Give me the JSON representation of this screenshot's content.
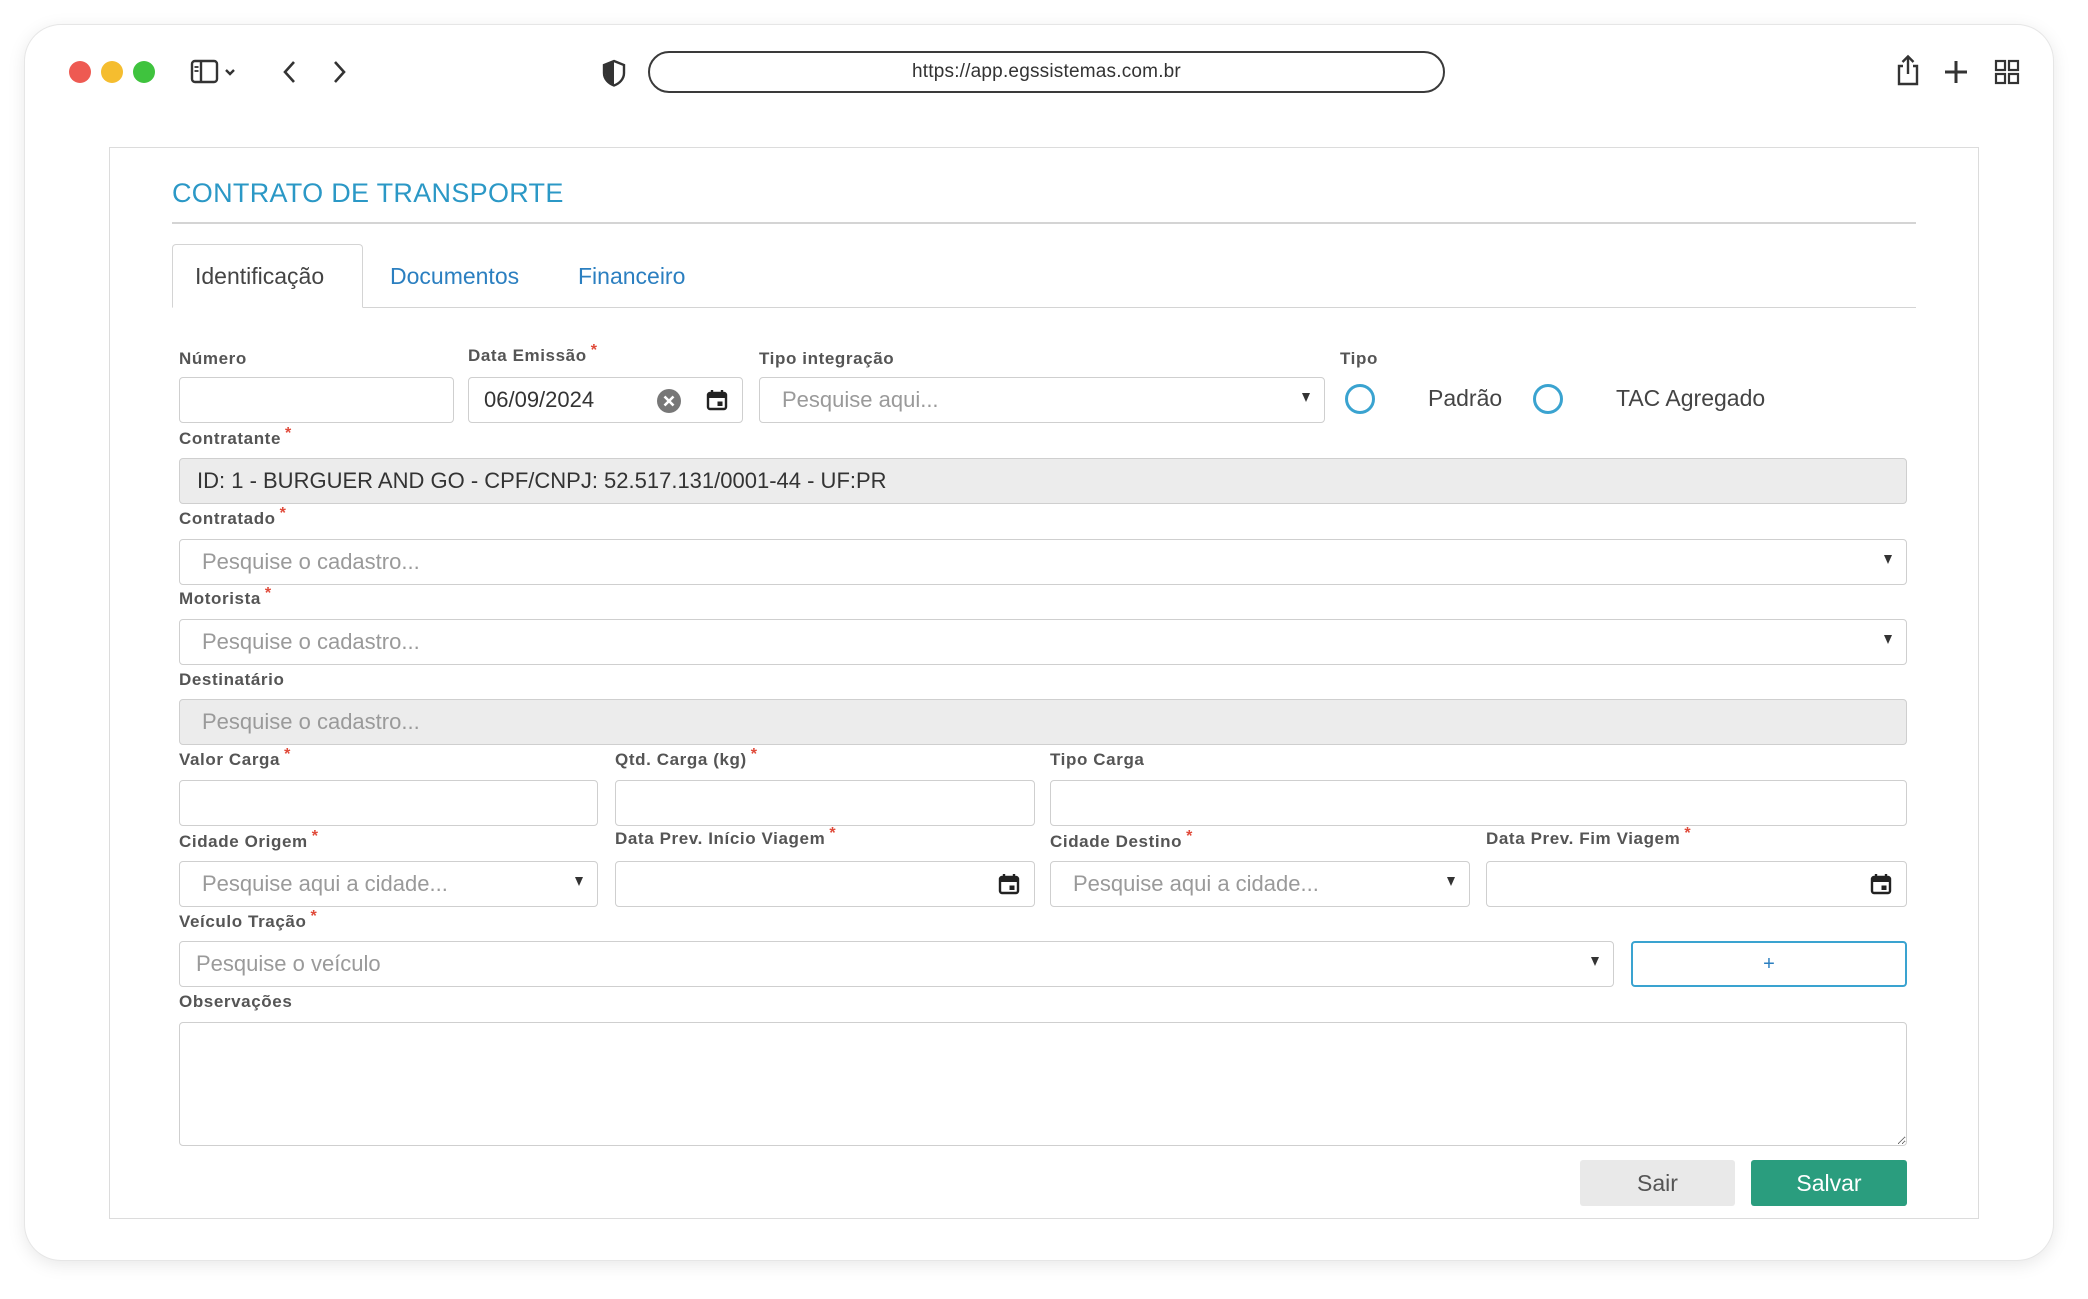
{
  "browser": {
    "url": "https://app.egssistemas.com.br"
  },
  "page": {
    "title": "CONTRATO DE TRANSPORTE",
    "tabs": [
      {
        "label": "Identificação",
        "active": true
      },
      {
        "label": "Documentos",
        "active": false
      },
      {
        "label": "Financeiro",
        "active": false
      }
    ]
  },
  "form": {
    "numero": {
      "label": "Número",
      "value": ""
    },
    "data_emissao": {
      "label": "Data Emissão",
      "value": "06/09/2024",
      "required": true
    },
    "tipo_integracao": {
      "label": "Tipo integração",
      "placeholder": "Pesquise aqui..."
    },
    "tipo": {
      "label": "Tipo",
      "options": [
        "Padrão",
        "TAC Agregado"
      ]
    },
    "contratante": {
      "label": "Contratante",
      "value": "ID: 1 - BURGUER AND GO - CPF/CNPJ: 52.517.131/0001-44 - UF:PR",
      "required": true
    },
    "contratado": {
      "label": "Contratado",
      "placeholder": "Pesquise o cadastro...",
      "required": true
    },
    "motorista": {
      "label": "Motorista",
      "placeholder": "Pesquise o cadastro...",
      "required": true
    },
    "destinatario": {
      "label": "Destinatário",
      "placeholder": "Pesquise o cadastro..."
    },
    "valor_carga": {
      "label": "Valor Carga",
      "required": true
    },
    "qtd_carga": {
      "label": "Qtd. Carga (kg)",
      "required": true
    },
    "tipo_carga": {
      "label": "Tipo Carga"
    },
    "cidade_origem": {
      "label": "Cidade Origem",
      "placeholder": "Pesquise aqui a cidade...",
      "required": true
    },
    "data_inicio": {
      "label": "Data Prev. Início Viagem",
      "required": true
    },
    "cidade_destino": {
      "label": "Cidade Destino",
      "placeholder": "Pesquise aqui a cidade...",
      "required": true
    },
    "data_fim": {
      "label": "Data Prev. Fim Viagem",
      "required": true
    },
    "veiculo": {
      "label": "Veículo Tração",
      "placeholder": "Pesquise o veículo",
      "required": true,
      "add_label": "+"
    },
    "observacoes": {
      "label": "Observações"
    }
  },
  "actions": {
    "sair": "Sair",
    "salvar": "Salvar"
  },
  "required_mark": "*",
  "colors": {
    "accent": "#2b98c6",
    "save": "#2a9d7e",
    "required": "#e04a3a"
  }
}
